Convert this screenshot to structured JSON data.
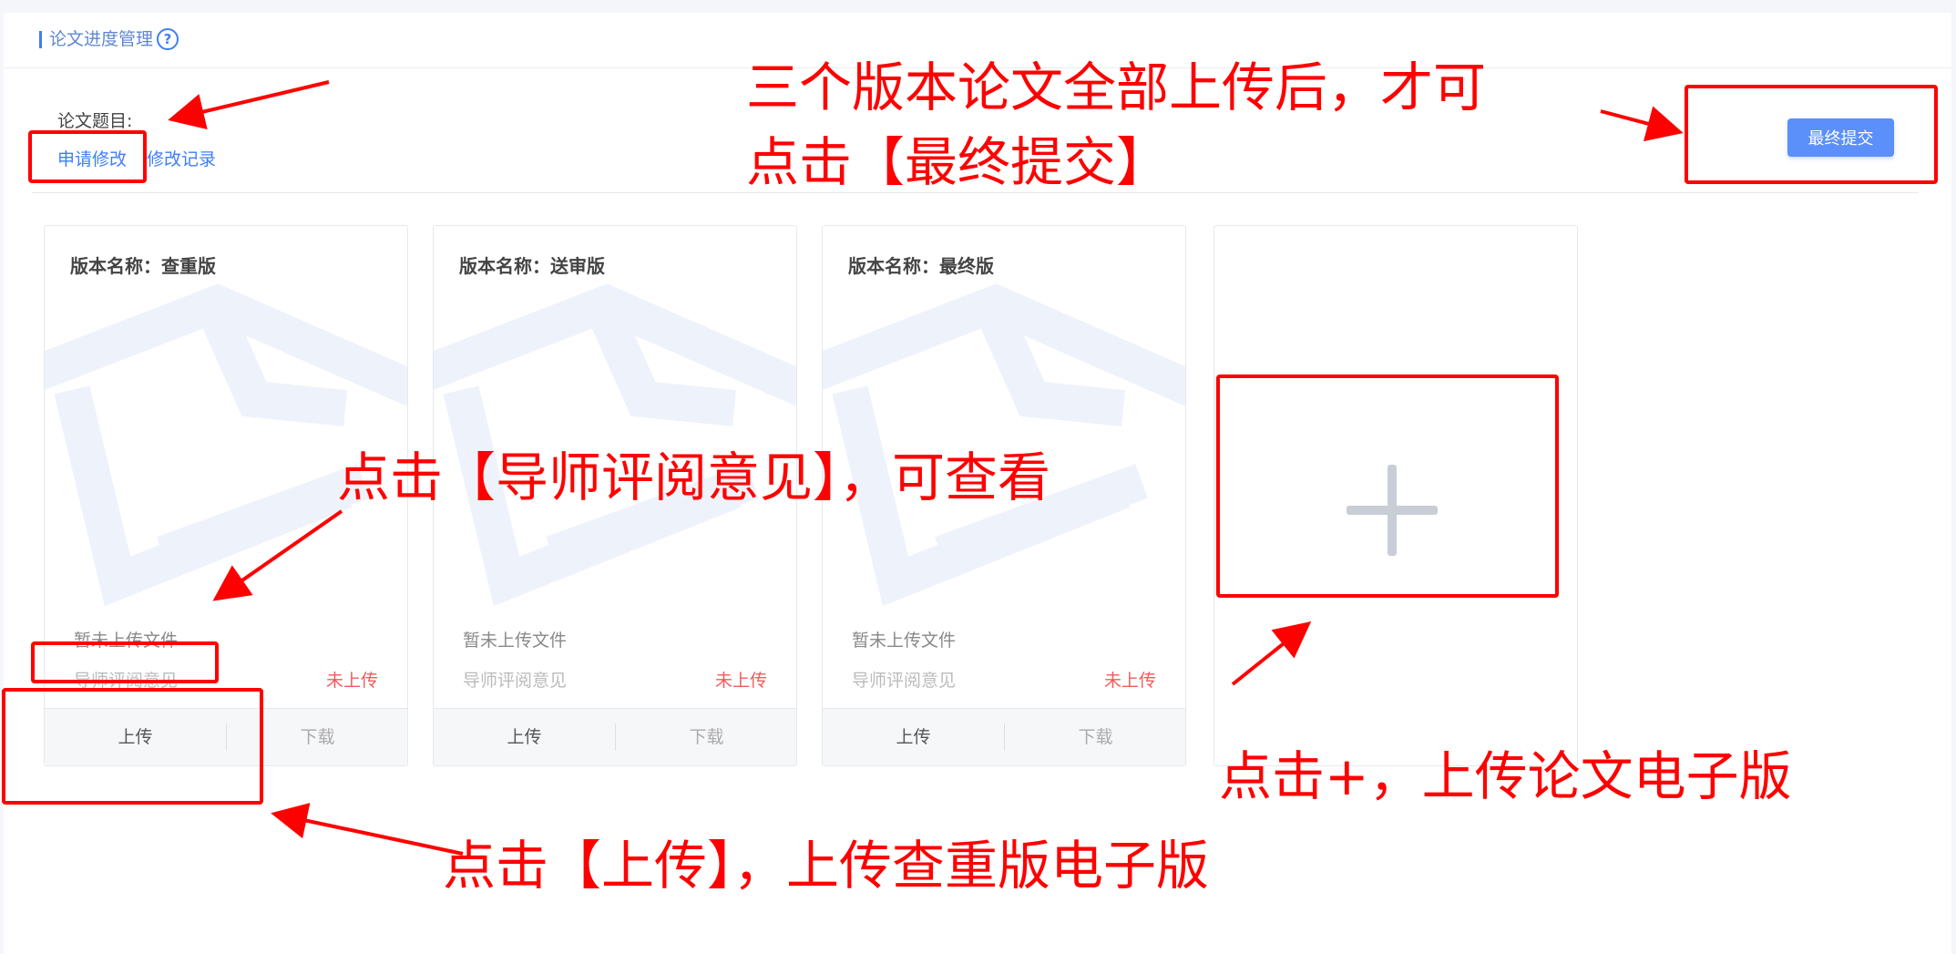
{
  "header": {
    "title": "论文进度管理",
    "help_icon": "?"
  },
  "thesis": {
    "topic_label": "论文题目:"
  },
  "links": {
    "apply": "申请修改",
    "log": "修改记录"
  },
  "final_submit_label": "最终提交",
  "cards": [
    {
      "name": "版本名称：查重版",
      "file_status": "暂未上传文件",
      "review_label": "导师评阅意见",
      "upload_status": "未上传",
      "upload": "上传",
      "download": "下载"
    },
    {
      "name": "版本名称：送审版",
      "file_status": "暂未上传文件",
      "review_label": "导师评阅意见",
      "upload_status": "未上传",
      "upload": "上传",
      "download": "下载"
    },
    {
      "name": "版本名称：最终版",
      "file_status": "暂未上传文件",
      "review_label": "导师评阅意见",
      "upload_status": "未上传",
      "upload": "上传",
      "download": "下载"
    }
  ],
  "annotations": {
    "final_note_line1": "三个版本论文全部上传后，才可",
    "final_note_line2": "点击【最终提交】",
    "review_note": "点击【导师评阅意见】，可查看",
    "add_note": "点击+，上传论文电子版",
    "upload_note": "点击【上传】，上传查重版电子版"
  },
  "colors": {
    "accent": "#3f7ef7",
    "annotation": "#ff0000",
    "status_red": "#f25a5a"
  }
}
